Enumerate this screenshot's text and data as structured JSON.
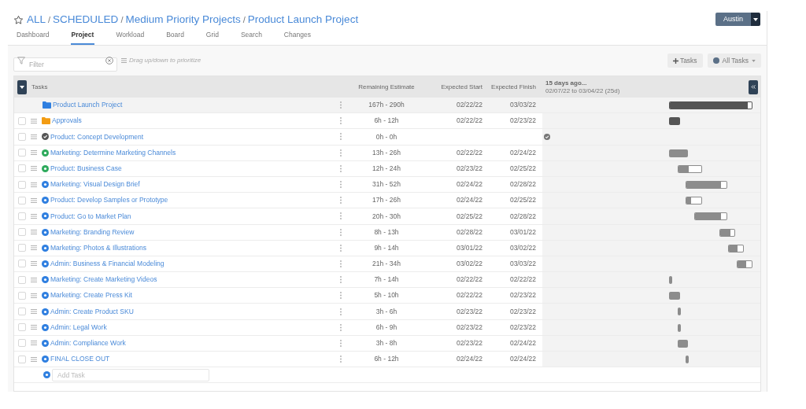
{
  "breadcrumb": [
    "ALL",
    "SCHEDULED",
    "Medium Priority Projects",
    "Product Launch Project"
  ],
  "breadcrumb_separator": "/",
  "user_button": {
    "label": "Austin"
  },
  "tabs": [
    {
      "label": "Dashboard",
      "selected": false
    },
    {
      "label": "Project",
      "selected": true
    },
    {
      "label": "Workload",
      "selected": false
    },
    {
      "label": "Board",
      "selected": false
    },
    {
      "label": "Grid",
      "selected": false
    },
    {
      "label": "Search",
      "selected": false
    },
    {
      "label": "Changes",
      "selected": false
    }
  ],
  "filter": {
    "placeholder": "Filter"
  },
  "drag_hint": "Drag up/down to prioritize",
  "toolbar_buttons": {
    "add_tasks": "Tasks",
    "all_tasks": "All Tasks"
  },
  "table": {
    "columns": [
      "Tasks",
      "Remaining Estimate",
      "Expected Start",
      "Expected Finish"
    ],
    "timeline": {
      "title": "15 days ago...",
      "range": "02/07/22 to 03/04/22 (25d)"
    },
    "rows": [
      {
        "kind": "project",
        "color": "#2f7fe0",
        "name": "Product Launch Project",
        "estimate": "167h - 290h",
        "start": "02/22/22",
        "finish": "03/03/22",
        "level": 0.95
      },
      {
        "kind": "folder",
        "color": "#f39c12",
        "checked": false,
        "name": "Approvals",
        "estimate": "6h - 12h",
        "start": "02/22/22",
        "finish": "02/23/22"
      },
      {
        "kind": "done",
        "checked": false,
        "name": "Product: Concept Development",
        "estimate": "0h - 0h"
      },
      {
        "kind": "started",
        "checked": false,
        "name": "Marketing: Determine Marketing Channels",
        "estimate": "13h - 26h",
        "start": "02/22/22",
        "finish": "02/24/22"
      },
      {
        "kind": "started",
        "checked": false,
        "name": "Product: Business Case",
        "estimate": "12h - 24h",
        "start": "02/23/22",
        "finish": "02/25/22",
        "level": 0.45
      },
      {
        "kind": "scheduled",
        "checked": false,
        "name": "Marketing: Visual Design Brief",
        "estimate": "31h - 52h",
        "start": "02/24/22",
        "finish": "02/28/22",
        "level": 0.87
      },
      {
        "kind": "scheduled",
        "checked": false,
        "name": "Product: Develop Samples or Prototype",
        "estimate": "17h - 26h",
        "start": "02/24/22",
        "finish": "02/25/22",
        "level": 0.3
      },
      {
        "kind": "scheduled",
        "checked": false,
        "name": "Product: Go to Market Plan",
        "estimate": "20h - 30h",
        "start": "02/25/22",
        "finish": "02/28/22",
        "level": 0.84
      },
      {
        "kind": "scheduled",
        "checked": false,
        "name": "Marketing: Branding Review",
        "estimate": "8h - 13h",
        "start": "02/28/22",
        "finish": "03/01/22",
        "level": 0.68
      },
      {
        "kind": "scheduled",
        "checked": false,
        "name": "Marketing: Photos & Illustrations",
        "estimate": "9h - 14h",
        "start": "03/01/22",
        "finish": "03/02/22",
        "level": 0.62
      },
      {
        "kind": "scheduled",
        "checked": false,
        "name": "Admin: Business & Financial Modeling",
        "estimate": "21h - 34h",
        "start": "03/02/22",
        "finish": "03/03/22",
        "level": 0.6
      },
      {
        "kind": "scheduled",
        "checked": false,
        "name": "Marketing: Create Marketing Videos",
        "estimate": "7h - 14h",
        "start": "02/22/22",
        "finish": "02/22/22"
      },
      {
        "kind": "scheduled",
        "checked": false,
        "name": "Marketing: Create Press Kit",
        "estimate": "5h - 10h",
        "start": "02/22/22",
        "finish": "02/23/22"
      },
      {
        "kind": "scheduled",
        "checked": false,
        "name": "Admin: Create Product SKU",
        "estimate": "3h - 6h",
        "start": "02/23/22",
        "finish": "02/23/22"
      },
      {
        "kind": "scheduled",
        "checked": false,
        "name": "Admin: Legal Work",
        "estimate": "6h - 9h",
        "start": "02/23/22",
        "finish": "02/23/22"
      },
      {
        "kind": "scheduled",
        "checked": false,
        "name": "Admin: Compliance Work",
        "estimate": "3h - 8h",
        "start": "02/23/22",
        "finish": "02/24/22"
      },
      {
        "kind": "scheduled",
        "checked": false,
        "name": "FINAL CLOSE OUT",
        "estimate": "6h - 12h",
        "start": "02/24/22",
        "finish": "02/24/22"
      }
    ],
    "add_task": {
      "placeholder": "Add Task"
    }
  }
}
